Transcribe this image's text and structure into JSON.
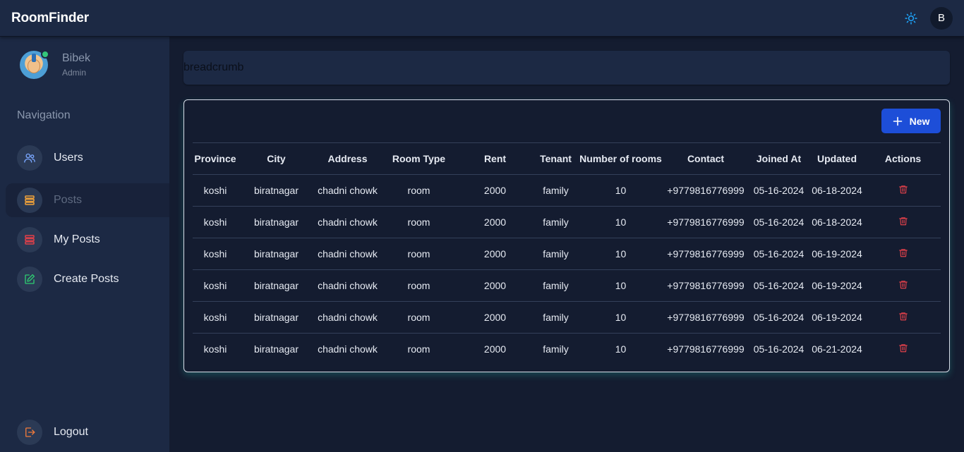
{
  "app": {
    "title": "RoomFinder"
  },
  "topbar": {
    "theme_icon": "sun-icon",
    "user_initial": "B",
    "accent": "#1ea7ff"
  },
  "profile": {
    "name": "Bibek",
    "role": "Admin"
  },
  "nav": {
    "heading": "Navigation",
    "items": [
      {
        "label": "Users",
        "icon": "users-icon",
        "color": "#7aa7ff"
      },
      {
        "label": "Posts",
        "icon": "stack-icon",
        "color": "#f2a33a",
        "active": true
      },
      {
        "label": "My Posts",
        "icon": "stack-icon",
        "color": "#e0404a"
      },
      {
        "label": "Create Posts",
        "icon": "edit-icon",
        "color": "#2ecc71"
      }
    ],
    "logout": {
      "label": "Logout",
      "icon": "logout-icon",
      "color": "#f07a3a"
    }
  },
  "breadcrumb": {
    "text": "breadcrumb"
  },
  "actions": {
    "new_label": "New"
  },
  "table": {
    "columns": [
      "Province",
      "City",
      "Address",
      "Room Type",
      "Rent",
      "Tenant",
      "Number of rooms",
      "Contact",
      "Joined At",
      "Updated",
      "Actions"
    ],
    "rows": [
      [
        "koshi",
        "biratnagar",
        "chadni chowk",
        "room",
        "2000",
        "family",
        "10",
        "+9779816776999",
        "05-16-2024",
        "06-18-2024"
      ],
      [
        "koshi",
        "biratnagar",
        "chadni chowk",
        "room",
        "2000",
        "family",
        "10",
        "+9779816776999",
        "05-16-2024",
        "06-18-2024"
      ],
      [
        "koshi",
        "biratnagar",
        "chadni chowk",
        "room",
        "2000",
        "family",
        "10",
        "+9779816776999",
        "05-16-2024",
        "06-19-2024"
      ],
      [
        "koshi",
        "biratnagar",
        "chadni chowk",
        "room",
        "2000",
        "family",
        "10",
        "+9779816776999",
        "05-16-2024",
        "06-19-2024"
      ],
      [
        "koshi",
        "biratnagar",
        "chadni chowk",
        "room",
        "2000",
        "family",
        "10",
        "+9779816776999",
        "05-16-2024",
        "06-19-2024"
      ],
      [
        "koshi",
        "biratnagar",
        "chadni chowk",
        "room",
        "2000",
        "family",
        "10",
        "+9779816776999",
        "05-16-2024",
        "06-21-2024"
      ]
    ],
    "delete_icon": "trash-icon",
    "delete_color": "#e0404a"
  }
}
